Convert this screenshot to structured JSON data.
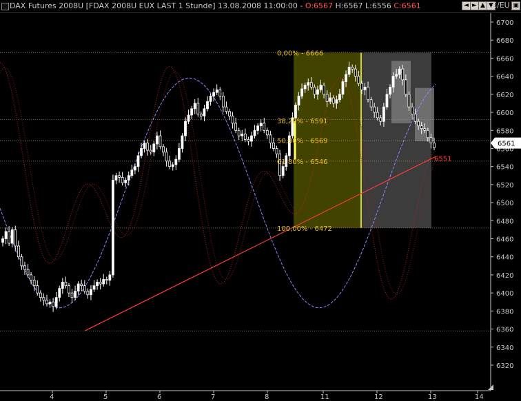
{
  "window": {
    "title_prefix": "DAX Futures 2008U [FDAX 2008U EUX LAST 1 Stunde] 13.08.2008 11:00:00 - ",
    "open": "O:6567",
    "hl": "H:6567 L:6556",
    "close": "C:6561",
    "axis_unit": "€/EU",
    "buttons": [
      "◄",
      "►",
      "▲",
      "▼",
      "▣"
    ]
  },
  "colors": {
    "background": "#000000",
    "candle": "#ffffff",
    "fib_zone": "#5a5a00",
    "grey_zone": "#3c3c3c",
    "trendline": "#ff3b3b",
    "stoch_red": "#c02020",
    "stoch_blue": "#8a8aff",
    "fib_text": "#e8c020",
    "last_price_label_bg": "#ffffff"
  },
  "chart_data": {
    "type": "candlestick",
    "y_ticks": [
      6320,
      6340,
      6360,
      6380,
      6400,
      6420,
      6440,
      6460,
      6480,
      6500,
      6520,
      6540,
      6560,
      6580,
      6600,
      6620,
      6640,
      6660,
      6680,
      6700
    ],
    "x_ticks": [
      "4",
      "5",
      "6",
      "7",
      "8",
      "11",
      "12",
      "13",
      "14"
    ],
    "ylim": [
      6310,
      6710
    ],
    "last_price": "6561",
    "trendline_label": "6551",
    "fib_levels": [
      {
        "label": "0,00% - 6666",
        "value": 6666
      },
      {
        "label": "38,20% - 6591",
        "value": 6591
      },
      {
        "label": "50,00% - 6569",
        "value": 6569
      },
      {
        "label": "61,80% - 6546",
        "value": 6546
      },
      {
        "label": "100,00% - 6472",
        "value": 6472
      }
    ],
    "horizontal_lines": [
      6666,
      6592,
      6569,
      6546,
      6472,
      6358
    ],
    "closes": [
      6460,
      6468,
      6455,
      6470,
      6452,
      6440,
      6430,
      6426,
      6420,
      6414,
      6408,
      6400,
      6395,
      6392,
      6388,
      6390,
      6385,
      6395,
      6405,
      6412,
      6408,
      6400,
      6395,
      6402,
      6410,
      6408,
      6402,
      6398,
      6404,
      6408,
      6412,
      6410,
      6415,
      6414,
      6420,
      6525,
      6530,
      6528,
      6522,
      6525,
      6530,
      6536,
      6540,
      6552,
      6560,
      6566,
      6558,
      6556,
      6565,
      6574,
      6562,
      6556,
      6546,
      6540,
      6542,
      6548,
      6560,
      6574,
      6590,
      6597,
      6604,
      6610,
      6598,
      6596,
      6604,
      6612,
      6618,
      6622,
      6625,
      6618,
      6606,
      6601,
      6596,
      6588,
      6580,
      6574,
      6576,
      6570,
      6568,
      6574,
      6580,
      6585,
      6588,
      6580,
      6575,
      6566,
      6560,
      6554,
      6530,
      6540,
      6552,
      6574,
      6594,
      6608,
      6618,
      6626,
      6630,
      6633,
      6628,
      6620,
      6625,
      6630,
      6620,
      6612,
      6616,
      6610,
      6614,
      6620,
      6634,
      6642,
      6650,
      6648,
      6640,
      6632,
      6625,
      6628,
      6614,
      6606,
      6600,
      6594,
      6590,
      6606,
      6620,
      6628,
      6640,
      6642,
      6648,
      6636,
      6620,
      6606,
      6598,
      6590,
      6585,
      6582,
      6580,
      6572,
      6566,
      6561
    ]
  }
}
